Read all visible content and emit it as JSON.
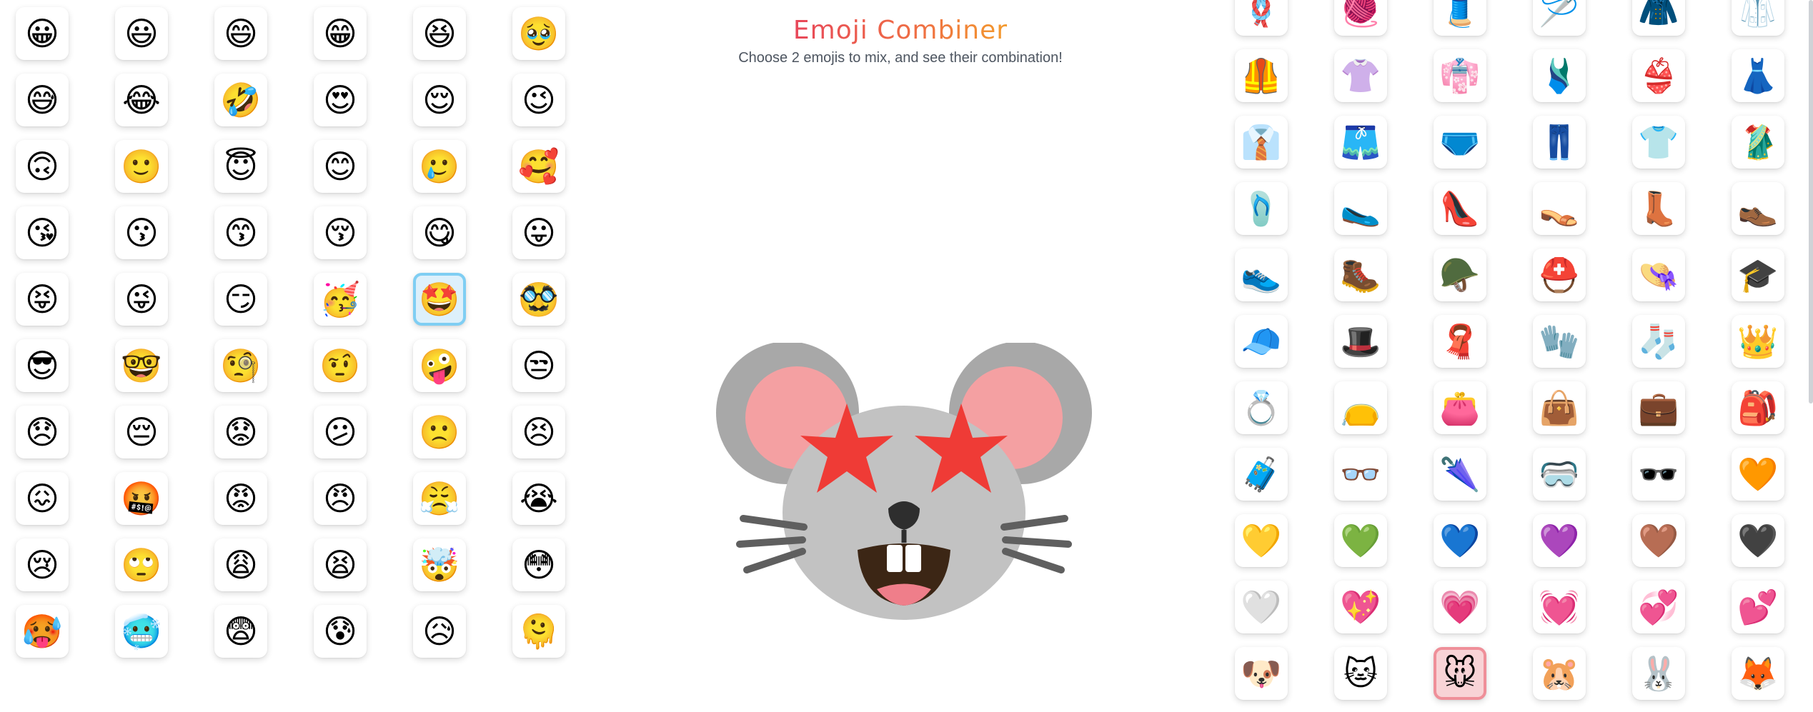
{
  "title": "Emoji Combiner",
  "subtitle": "Choose 2 emojis to mix, and see their combination!",
  "left_grid": {
    "selected_index": 28,
    "emojis": [
      "😀",
      "😃",
      "😄",
      "😁",
      "😆",
      "🥹",
      "😅",
      "😂",
      "🤣",
      "😍",
      "😌",
      "😉",
      "🙃",
      "🙂",
      "😇",
      "😊",
      "🥲",
      "🥰",
      "😘",
      "😗",
      "😙",
      "😚",
      "😋",
      "😛",
      "😝",
      "😜",
      "😏",
      "🥳",
      "🤩",
      "🥸",
      "😎",
      "🤓",
      "🧐",
      "🤨",
      "🤪",
      "😒",
      "😞",
      "😔",
      "😟",
      "😕",
      "🙁",
      "😣",
      "😖",
      "🤬",
      "😡",
      "😠",
      "😤",
      "😭",
      "😢",
      "🙄",
      "😩",
      "😫",
      "🤯",
      "😳",
      "🥵",
      "🥶",
      "😨",
      "😰",
      "😥",
      "🫠"
    ]
  },
  "right_grid": {
    "selected_index": 62,
    "emojis": [
      "🪢",
      "🧶",
      "🧵",
      "🪡",
      "🧥",
      "🥼",
      "🦺",
      "👚",
      "👘",
      "🩱",
      "👙",
      "👗",
      "👔",
      "🩳",
      "🩲",
      "👖",
      "👕",
      "🥻",
      "🩴",
      "🥿",
      "👠",
      "👡",
      "👢",
      "👞",
      "👟",
      "🥾",
      "🪖",
      "⛑️",
      "👒",
      "🎓",
      "🧢",
      "🎩",
      "🧣",
      "🧤",
      "🧦",
      "👑",
      "💍",
      "👝",
      "👛",
      "👜",
      "💼",
      "🎒",
      "🧳",
      "👓",
      "🌂",
      "🥽",
      "🕶️",
      "🧡",
      "💛",
      "💚",
      "💙",
      "💜",
      "🤎",
      "🖤",
      "🤍",
      "💖",
      "💗",
      "💓",
      "💞",
      "💕",
      "🐶",
      "🐱",
      "🐭",
      "🐹",
      "🐰",
      "🦊"
    ]
  },
  "combined_result": {
    "emoji_a": "🤩",
    "emoji_b": "🐭"
  },
  "colors": {
    "title_gradient_start": "#e8475a",
    "title_gradient_end": "#f39a2c",
    "left_selected_border": "#7fcef3",
    "right_selected_border": "#ef8f99",
    "mouse_gray": "#a8a8a8",
    "mouse_face": "#c2c2c2",
    "mouse_ear_inner": "#f4a0a2",
    "star_red": "#ef3b36"
  }
}
